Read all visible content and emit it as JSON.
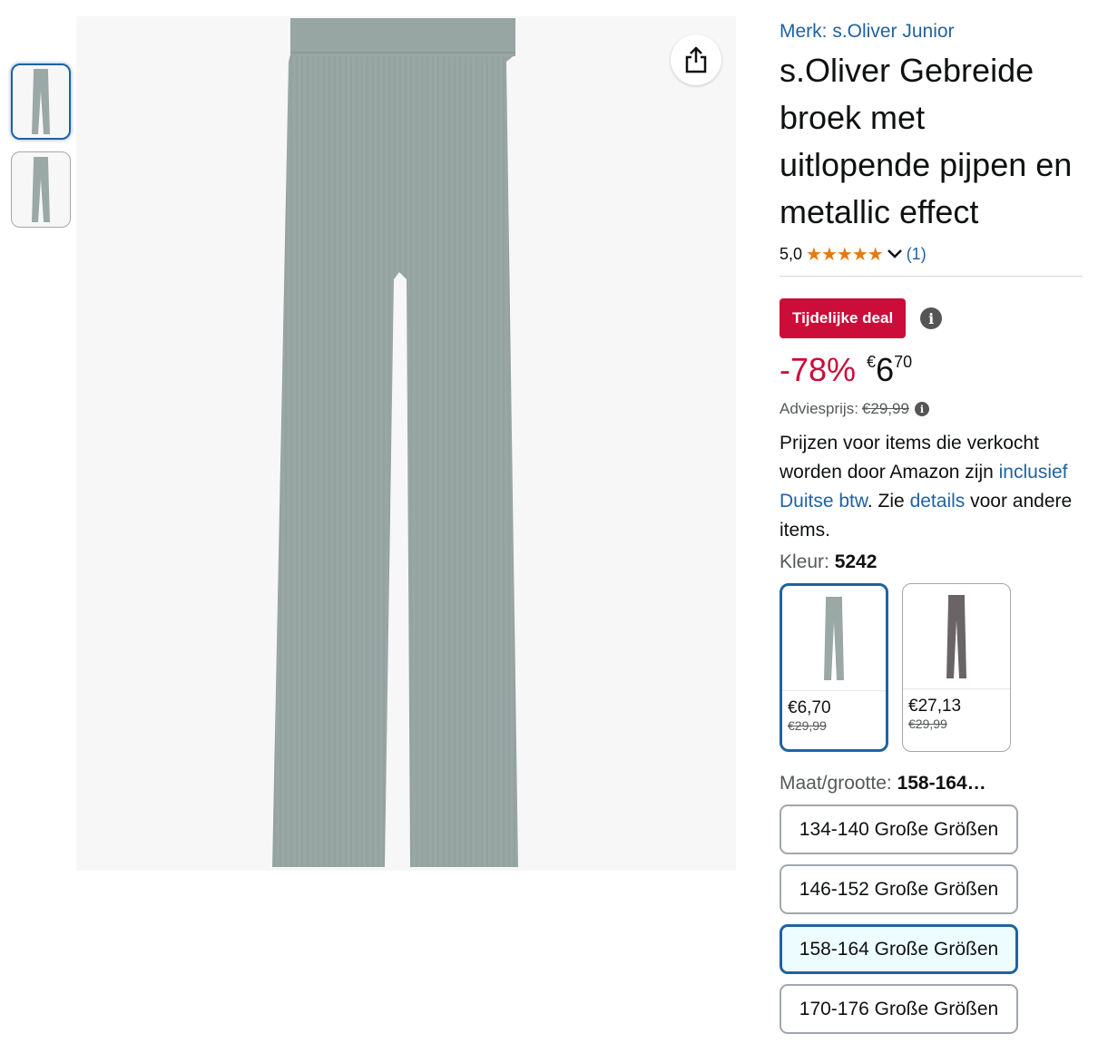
{
  "brand_text": "Merk: s.Oliver Junior",
  "title": "s.Oliver Gebreide broek met uitlopende pijpen en metallic effect",
  "rating": {
    "value": "5,0",
    "stars": "★★★★★",
    "count_label": "(1)"
  },
  "deal_badge": "Tijdelijke deal",
  "price": {
    "discount": "-78%",
    "currency": "€",
    "whole": "6",
    "fraction": "70"
  },
  "list_price": {
    "label": "Adviesprijs:",
    "value": "€29,99"
  },
  "vat_text": {
    "part1": "Prijzen voor items die verkocht worden door Amazon zijn ",
    "link1": "inclusief Duitse btw",
    "part2": ". Zie ",
    "link2": "details",
    "part3": " voor andere items."
  },
  "color": {
    "label": "Kleur:",
    "value": "5242"
  },
  "swatches": [
    {
      "price": "€6,70",
      "list": "€29,99",
      "color": "#9aa8a6"
    },
    {
      "price": "€27,13",
      "list": "€29,99",
      "color": "#6a6466"
    }
  ],
  "size": {
    "label": "Maat/grootte:",
    "value": "158-164…",
    "options": [
      "134-140 Große Größen",
      "146-152 Große Größen",
      "158-164 Große Größen",
      "170-176 Große Größen"
    ]
  },
  "colors": {
    "link": "#2162a1",
    "deal": "#cc0c39",
    "star": "#e47911",
    "fabric": "#9aa8a6"
  },
  "icons": [
    "share-icon",
    "info-icon",
    "chevron-down-icon",
    "star-icon"
  ]
}
